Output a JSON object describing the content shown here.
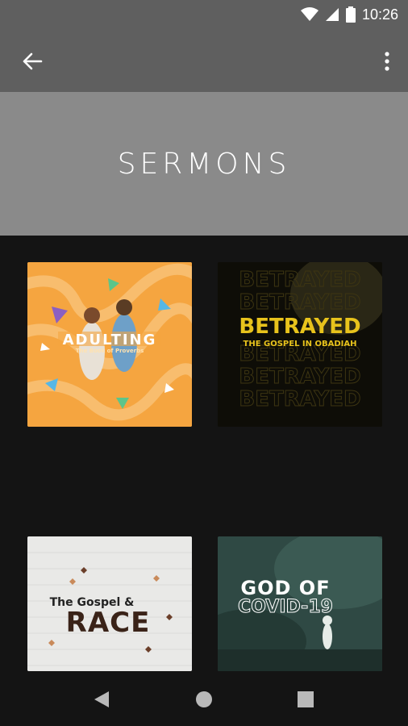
{
  "status_bar": {
    "time": "10:26",
    "icons": [
      "wifi-icon",
      "cell-signal-icon",
      "battery-icon"
    ]
  },
  "app_bar": {
    "back_icon": "arrow-left-icon",
    "menu_icon": "more-vert-icon"
  },
  "hero": {
    "title": "SERMONS"
  },
  "sermons": [
    {
      "title": "ADULTING",
      "subtitle": "The Book of Proverbs"
    },
    {
      "title": "BETRAYED",
      "subtitle": "THE GOSPEL IN OBADIAH"
    },
    {
      "title": "RACE",
      "subtitle": "The Gospel &"
    },
    {
      "title": "GOD OF",
      "subtitle": "COVID-19"
    }
  ],
  "nav_bar": {
    "icons": [
      "back-triangle-icon",
      "home-circle-icon",
      "recents-square-icon"
    ]
  },
  "colors": {
    "app_bar": "#5f5f5f",
    "hero": "#8a8a8a",
    "background": "#141414",
    "betrayed_yellow": "#e8c31c",
    "adulting_orange": "#f5a540"
  }
}
